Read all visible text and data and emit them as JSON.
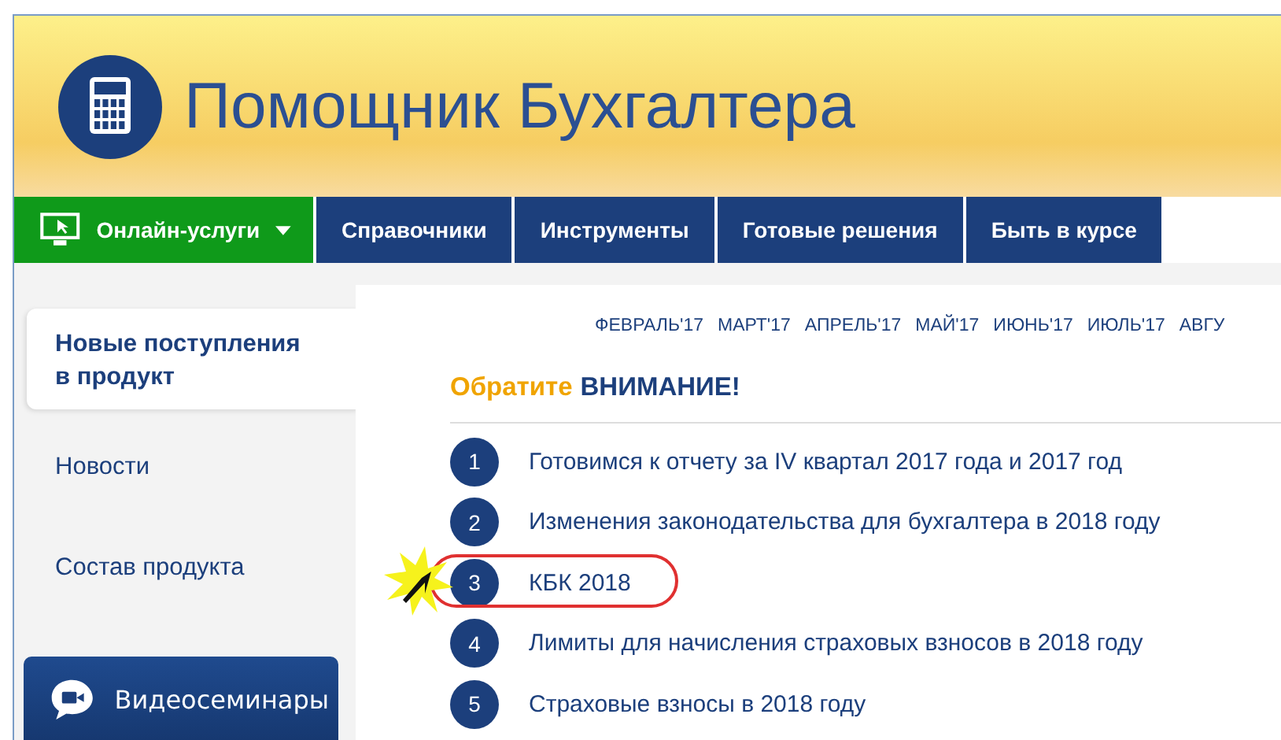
{
  "header": {
    "title": "Помощник Бухгалтера"
  },
  "nav": [
    {
      "kind": "dropdown",
      "label": "Онлайн-услуги"
    },
    {
      "kind": "link",
      "label": "Справочники"
    },
    {
      "kind": "link",
      "label": "Инструменты"
    },
    {
      "kind": "link",
      "label": "Готовые решения"
    },
    {
      "kind": "link",
      "label": "Быть в курсе"
    }
  ],
  "sidebar": {
    "items": [
      {
        "label": "Новые поступления в продукт",
        "selected": true
      },
      {
        "label": "Новости",
        "selected": false
      },
      {
        "label": "Состав продукта",
        "selected": false
      }
    ],
    "video_button": "Видеосеминары"
  },
  "months": [
    "ФЕВРАЛЬ'17",
    "МАРТ'17",
    "АПРЕЛЬ'17",
    "МАЙ'17",
    "ИЮНЬ'17",
    "ИЮЛЬ'17",
    "АВГУ"
  ],
  "attention": {
    "lead": "Обратите",
    "main": "ВНИМАНИЕ!"
  },
  "items": [
    {
      "number": "1",
      "text": "Готовимся к отчету за IV квартал 2017 года и 2017 год",
      "highlighted": false
    },
    {
      "number": "2",
      "text": "Изменения законодательства для бухгалтера в 2018 году",
      "highlighted": false
    },
    {
      "number": "3",
      "text": "КБК 2018",
      "highlighted": true
    },
    {
      "number": "4",
      "text": "Лимиты для начисления страховых взносов в 2018 году",
      "highlighted": false
    },
    {
      "number": "5",
      "text": "Страховые взносы в 2018 году",
      "highlighted": false
    }
  ]
}
